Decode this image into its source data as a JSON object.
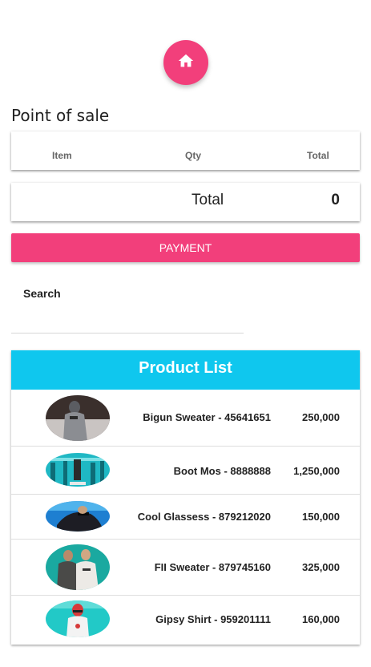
{
  "header": {
    "home_icon": "home-icon",
    "fab_color": "#f23f7b"
  },
  "page_title": "Point of sale",
  "order_table": {
    "columns": [
      "Item",
      "Qty",
      "Total"
    ]
  },
  "total": {
    "label": "Total",
    "value": "0"
  },
  "payment_button": {
    "label": "PAYMENT",
    "color": "#f23f7b"
  },
  "search": {
    "label": "Search",
    "value": ""
  },
  "product_list": {
    "title": "Product List",
    "header_color": "#0fc7ee",
    "items": [
      {
        "name": "Bigun Sweater - 45641651",
        "price": "250,000"
      },
      {
        "name": "Boot Mos - 8888888",
        "price": "1,250,000"
      },
      {
        "name": "Cool Glassess - 879212020",
        "price": "150,000"
      },
      {
        "name": "FII Sweater - 879745160",
        "price": "325,000"
      },
      {
        "name": "Gipsy Shirt - 959201111",
        "price": "160,000"
      }
    ]
  }
}
